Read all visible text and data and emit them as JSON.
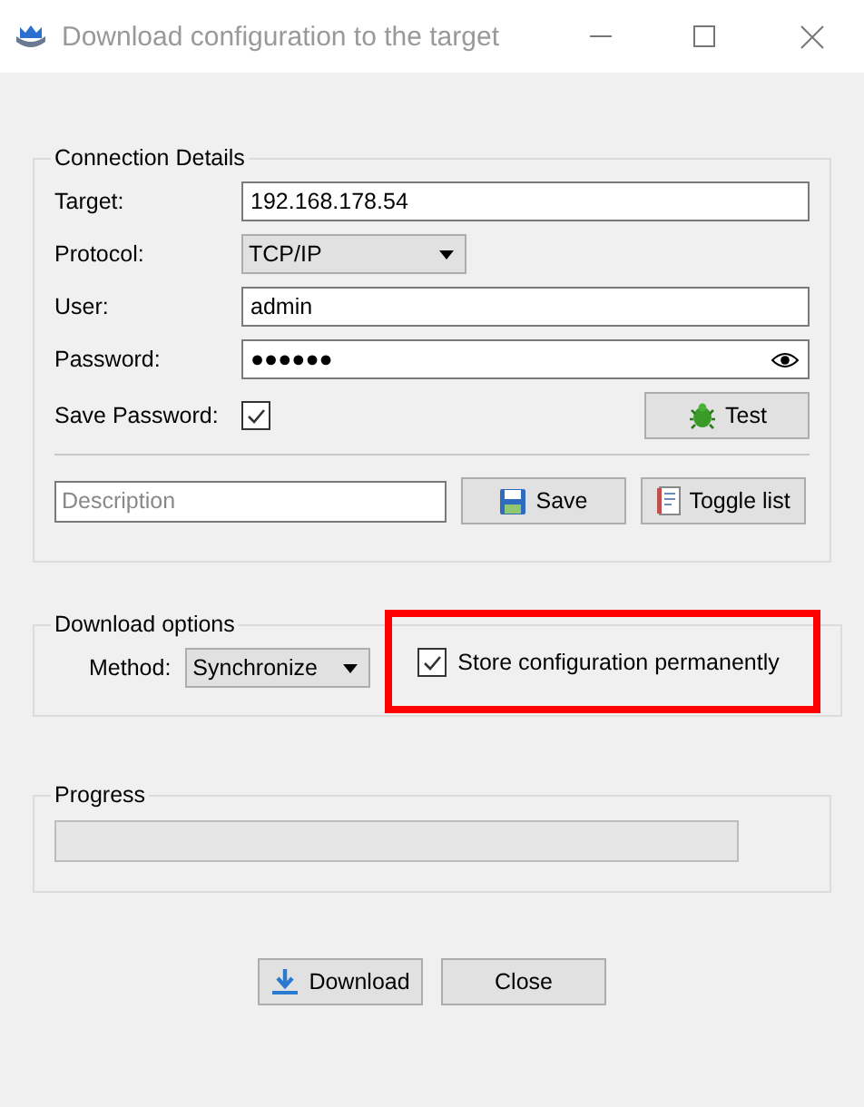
{
  "window": {
    "title": "Download configuration to the target"
  },
  "connection": {
    "title": "Connection Details",
    "target": {
      "label": "Target:",
      "value": "192.168.178.54"
    },
    "protocol": {
      "label": "Protocol:",
      "value": "TCP/IP"
    },
    "user": {
      "label": "User:",
      "value": "admin"
    },
    "password": {
      "label": "Password:",
      "value": "●●●●●●"
    },
    "save_password": {
      "label": "Save Password:",
      "checked": true
    },
    "test_button": "Test",
    "description": {
      "placeholder": "Description"
    },
    "save_button": "Save",
    "toggle_button": "Toggle list"
  },
  "download_options": {
    "title": "Download options",
    "method": {
      "label": "Method:",
      "value": "Synchronize"
    },
    "store": {
      "label": "Store configuration permanently",
      "checked": true,
      "highlighted": true
    }
  },
  "progress": {
    "title": "Progress",
    "level": 0
  },
  "buttons": {
    "download": "Download",
    "close": "Close"
  }
}
